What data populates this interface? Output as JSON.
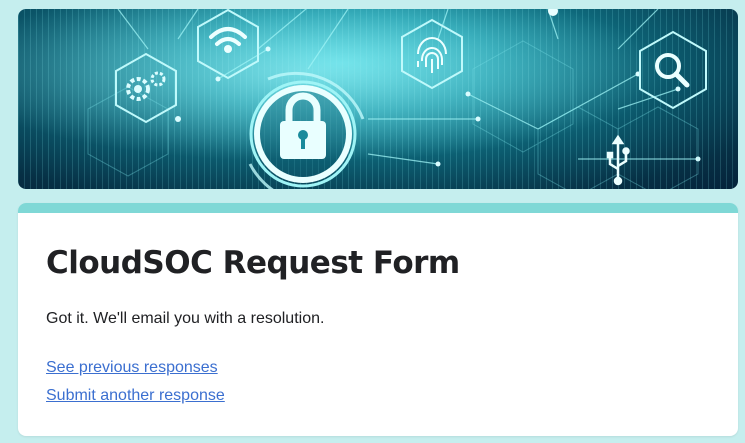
{
  "banner": {
    "alt": "Cybersecurity themed header image",
    "icons": [
      "gears-icon",
      "wifi-icon",
      "lock-icon",
      "fingerprint-icon",
      "magnifier-icon",
      "usb-icon"
    ],
    "colors": {
      "dark": "#04223a",
      "glow": "#3fd2dc",
      "line": "#9ff4f6"
    }
  },
  "form": {
    "title": "CloudSOC Request Form",
    "confirmation": "Got it. We'll email you with a resolution.",
    "links": {
      "previous": "See previous responses",
      "another": "Submit another response"
    },
    "accent_color": "#7fd8d6",
    "link_color": "#3b6fd0"
  }
}
